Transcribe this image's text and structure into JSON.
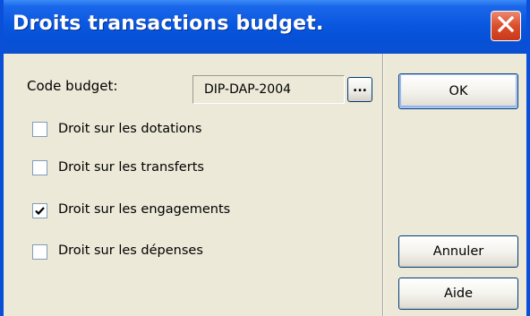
{
  "window": {
    "title": "Droits transactions budget."
  },
  "form": {
    "code_budget_label": "Code budget:",
    "code_budget_value": "DIP-DAP-2004",
    "browse_label": "..."
  },
  "checkboxes": [
    {
      "label": "Droit sur les dotations",
      "checked": false
    },
    {
      "label": "Droit sur les transferts",
      "checked": false
    },
    {
      "label": "Droit sur les engagements",
      "checked": true
    },
    {
      "label": "Droit sur les dépenses",
      "checked": false
    }
  ],
  "buttons": {
    "ok_label": "OK",
    "cancel_label": "Annuler",
    "help_label": "Aide"
  },
  "colors": {
    "title_bar": "#0a58e0",
    "close_button": "#dc4d2a",
    "dialog_bg": "#ece9d8"
  },
  "icons": {
    "close": "close-icon",
    "checkmark": "check-icon"
  }
}
